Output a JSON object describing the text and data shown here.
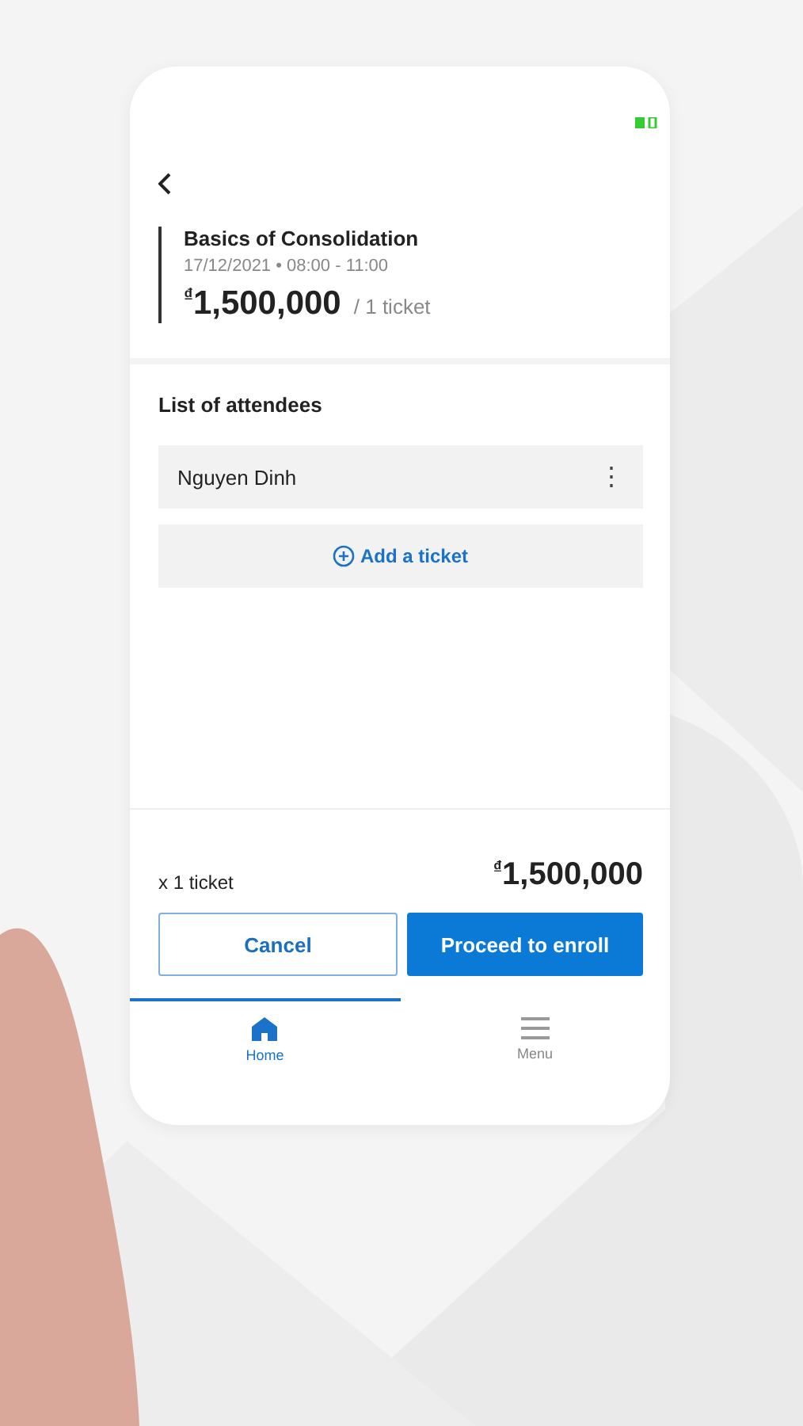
{
  "event": {
    "title": "Basics of Consolidation",
    "schedule": "17/12/2021 • 08:00 - 11:00",
    "price": "$^{₫}$1,500,000",
    "unit": "/ 1 ticket"
  },
  "attendees": {
    "heading": "List of attendees",
    "items": [
      {
        "name": "Nguyen Dinh",
        "menu_icon": "⋮"
      }
    ],
    "add_label": "Add a ticket"
  },
  "summary": {
    "quantity": "x 1 ticket",
    "total": "$^{₫}$1,500,000"
  },
  "buttons": {
    "cancel": "Cancel",
    "proceed": "Proceed to enroll"
  },
  "tabs": [
    {
      "label": "Home",
      "kind": "home",
      "selected": true
    },
    {
      "label": "Menu",
      "kind": "menu",
      "selected": false
    }
  ]
}
